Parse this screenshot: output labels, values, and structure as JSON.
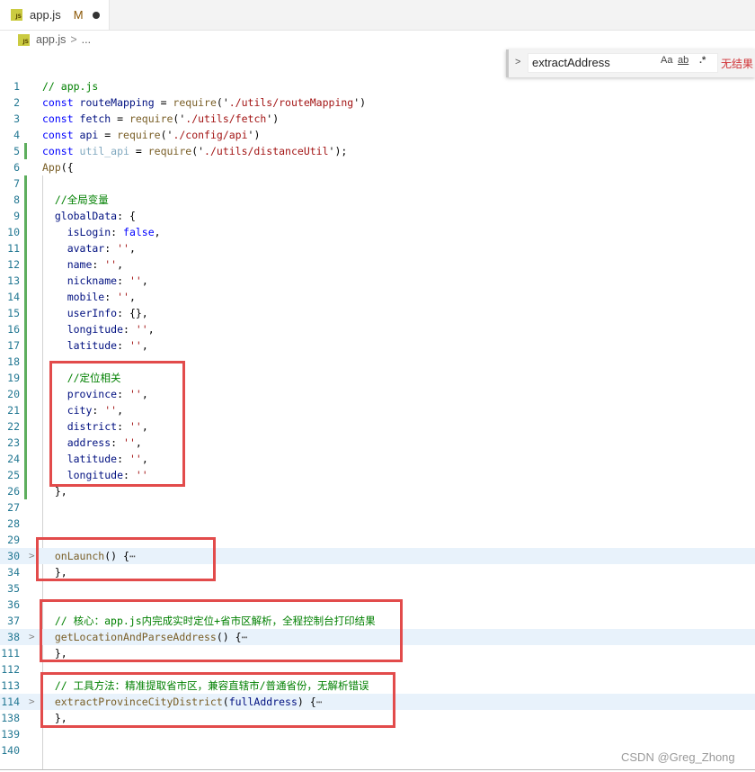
{
  "tab": {
    "file_icon": "js-file-icon",
    "icon_text": "JS",
    "name": "app.js",
    "status": "M"
  },
  "breadcrumb": {
    "file": "app.js",
    "separator": ">",
    "more": "..."
  },
  "find": {
    "toggle": ">",
    "query": "extractAddress",
    "match_case": "Aa",
    "match_word": "ab",
    "regex": ".*",
    "result": "无结果"
  },
  "watermark": "CSDN @Greg_Zhong",
  "colors": {
    "comment": "#008000",
    "keyword": "#0000ff",
    "string": "#a31515",
    "variable": "#001080",
    "function": "#795e26",
    "annotation_box": "#e24b4b",
    "line_number": "#237893"
  },
  "lines": [
    {
      "n": "1",
      "tokens": [
        [
          "// app.js",
          "cm"
        ]
      ]
    },
    {
      "n": "2",
      "tokens": [
        [
          "const ",
          "kw"
        ],
        [
          "routeMapping",
          "var"
        ],
        [
          " = ",
          "p"
        ],
        [
          "require",
          "fn"
        ],
        [
          "('",
          "p"
        ],
        [
          "./utils/routeMapping",
          "str"
        ],
        [
          "')",
          "p"
        ]
      ]
    },
    {
      "n": "3",
      "tokens": [
        [
          "const ",
          "kw"
        ],
        [
          "fetch",
          "var"
        ],
        [
          " = ",
          "p"
        ],
        [
          "require",
          "fn"
        ],
        [
          "('",
          "p"
        ],
        [
          "./utils/fetch",
          "str"
        ],
        [
          "')",
          "p"
        ]
      ]
    },
    {
      "n": "4",
      "tokens": [
        [
          "const ",
          "kw"
        ],
        [
          "api",
          "var"
        ],
        [
          " = ",
          "p"
        ],
        [
          "require",
          "fn"
        ],
        [
          "('",
          "p"
        ],
        [
          "./config/api",
          "str"
        ],
        [
          "')",
          "p"
        ]
      ]
    },
    {
      "n": "5",
      "tokens": [
        [
          "const ",
          "kw"
        ],
        [
          "util_api",
          "dim"
        ],
        [
          " = ",
          "p"
        ],
        [
          "require",
          "fn"
        ],
        [
          "('",
          "p"
        ],
        [
          "./utils/distanceUtil",
          "str"
        ],
        [
          "');",
          "p"
        ]
      ]
    },
    {
      "n": "6",
      "tokens": [
        [
          "App",
          "fn"
        ],
        [
          "({",
          "p"
        ]
      ]
    },
    {
      "n": "7",
      "tokens": []
    },
    {
      "n": "8",
      "tokens": [
        [
          "  //全局变量",
          "cm"
        ]
      ]
    },
    {
      "n": "9",
      "tokens": [
        [
          "  globalData",
          "var"
        ],
        [
          ": {",
          "p"
        ]
      ]
    },
    {
      "n": "10",
      "tokens": [
        [
          "    isLogin",
          "var"
        ],
        [
          ": ",
          "p"
        ],
        [
          "false",
          "kw"
        ],
        [
          ",",
          "p"
        ]
      ]
    },
    {
      "n": "11",
      "tokens": [
        [
          "    avatar",
          "var"
        ],
        [
          ": ",
          "p"
        ],
        [
          "''",
          "str"
        ],
        [
          ",",
          "p"
        ]
      ]
    },
    {
      "n": "12",
      "tokens": [
        [
          "    name",
          "var"
        ],
        [
          ": ",
          "p"
        ],
        [
          "''",
          "str"
        ],
        [
          ",",
          "p"
        ]
      ]
    },
    {
      "n": "13",
      "tokens": [
        [
          "    nickname",
          "var"
        ],
        [
          ": ",
          "p"
        ],
        [
          "''",
          "str"
        ],
        [
          ",",
          "p"
        ]
      ]
    },
    {
      "n": "14",
      "tokens": [
        [
          "    mobile",
          "var"
        ],
        [
          ": ",
          "p"
        ],
        [
          "''",
          "str"
        ],
        [
          ",",
          "p"
        ]
      ]
    },
    {
      "n": "15",
      "tokens": [
        [
          "    userInfo",
          "var"
        ],
        [
          ": {},",
          "p"
        ]
      ]
    },
    {
      "n": "16",
      "tokens": [
        [
          "    longitude",
          "var"
        ],
        [
          ": ",
          "p"
        ],
        [
          "''",
          "str"
        ],
        [
          ",",
          "p"
        ]
      ]
    },
    {
      "n": "17",
      "tokens": [
        [
          "    latitude",
          "var"
        ],
        [
          ": ",
          "p"
        ],
        [
          "''",
          "str"
        ],
        [
          ",",
          "p"
        ]
      ]
    },
    {
      "n": "18",
      "tokens": []
    },
    {
      "n": "19",
      "tokens": [
        [
          "    //定位相关",
          "cm"
        ]
      ]
    },
    {
      "n": "20",
      "tokens": [
        [
          "    province",
          "var"
        ],
        [
          ": ",
          "p"
        ],
        [
          "''",
          "str"
        ],
        [
          ",",
          "p"
        ]
      ]
    },
    {
      "n": "21",
      "tokens": [
        [
          "    city",
          "var"
        ],
        [
          ": ",
          "p"
        ],
        [
          "''",
          "str"
        ],
        [
          ",",
          "p"
        ]
      ]
    },
    {
      "n": "22",
      "tokens": [
        [
          "    district",
          "var"
        ],
        [
          ": ",
          "p"
        ],
        [
          "''",
          "str"
        ],
        [
          ",",
          "p"
        ]
      ]
    },
    {
      "n": "23",
      "tokens": [
        [
          "    address",
          "var"
        ],
        [
          ": ",
          "p"
        ],
        [
          "''",
          "str"
        ],
        [
          ",",
          "p"
        ]
      ]
    },
    {
      "n": "24",
      "tokens": [
        [
          "    latitude",
          "var"
        ],
        [
          ": ",
          "p"
        ],
        [
          "''",
          "str"
        ],
        [
          ",",
          "p"
        ]
      ]
    },
    {
      "n": "25",
      "tokens": [
        [
          "    longitude",
          "var"
        ],
        [
          ": ",
          "p"
        ],
        [
          "''",
          "str"
        ]
      ]
    },
    {
      "n": "26",
      "tokens": [
        [
          "  },",
          "p"
        ]
      ]
    },
    {
      "n": "27",
      "tokens": []
    },
    {
      "n": "28",
      "tokens": []
    },
    {
      "n": "29",
      "tokens": []
    },
    {
      "n": "30",
      "fold": true,
      "tokens": [
        [
          "  onLaunch",
          "fn"
        ],
        [
          "() {",
          "p"
        ],
        [
          "⋯",
          "ell"
        ]
      ]
    },
    {
      "n": "34",
      "tokens": [
        [
          "  },",
          "p"
        ]
      ]
    },
    {
      "n": "35",
      "tokens": []
    },
    {
      "n": "36",
      "tokens": []
    },
    {
      "n": "37",
      "tokens": [
        [
          "  // 核心：app.js内完成实时定位+省市区解析，全程控制台打印结果",
          "cm"
        ]
      ]
    },
    {
      "n": "38",
      "fold": true,
      "tokens": [
        [
          "  getLocationAndParseAddress",
          "fn"
        ],
        [
          "() {",
          "p"
        ],
        [
          "⋯",
          "ell"
        ]
      ]
    },
    {
      "n": "111",
      "tokens": [
        [
          "  },",
          "p"
        ]
      ]
    },
    {
      "n": "112",
      "tokens": []
    },
    {
      "n": "113",
      "tokens": [
        [
          "  // 工具方法：精准提取省市区，兼容直辖市/普通省份，无解析错误",
          "cm"
        ]
      ]
    },
    {
      "n": "114",
      "fold": true,
      "tokens": [
        [
          "  extractProvinceCityDistrict",
          "fn"
        ],
        [
          "(",
          "p"
        ],
        [
          "fullAddress",
          "var"
        ],
        [
          ") {",
          "p"
        ],
        [
          "⋯",
          "ell"
        ]
      ]
    },
    {
      "n": "138",
      "tokens": [
        [
          "  },",
          "p"
        ]
      ]
    },
    {
      "n": "139",
      "tokens": []
    },
    {
      "n": "140",
      "tokens": []
    }
  ]
}
